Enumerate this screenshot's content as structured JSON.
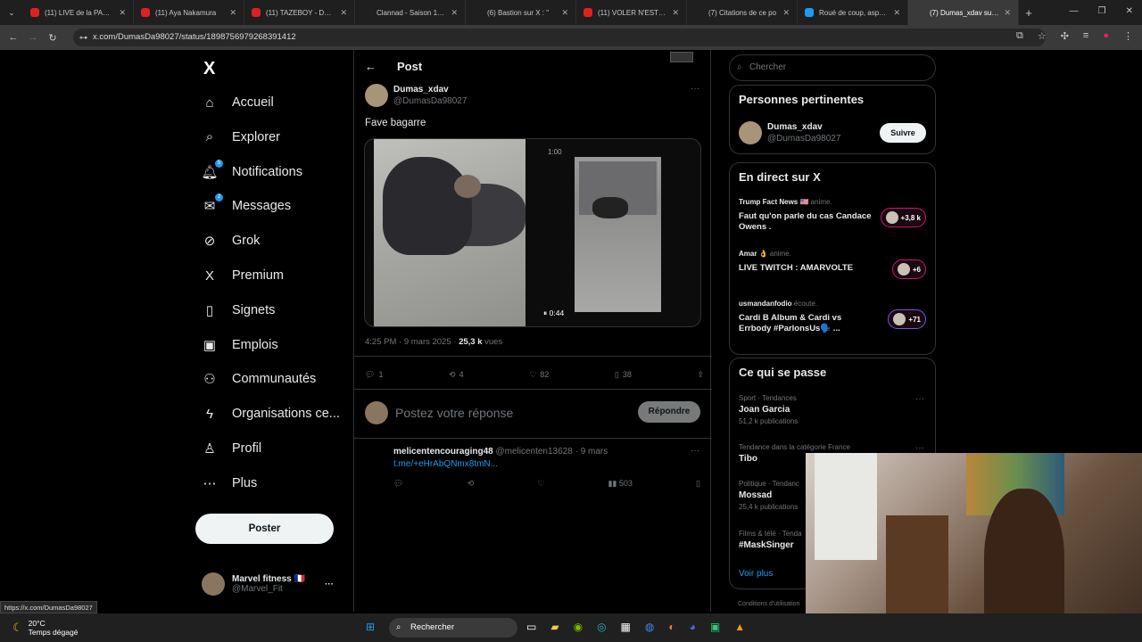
{
  "tabs": [
    {
      "title": "(11) LIVE de la PASSI",
      "color": "#e02020"
    },
    {
      "title": "(11) Aya Nakamura",
      "color": "#e02020"
    },
    {
      "title": "(11) TAZEBOY - Dans",
      "color": "#e02020"
    },
    {
      "title": "Clannad - Saison 1 | A",
      "color": "#ffffff"
    },
    {
      "title": "(6) Bastion sur X : \"",
      "color": "#ffffff"
    },
    {
      "title": "(11) VOLER N'EST PA",
      "color": "#e02020"
    },
    {
      "title": "(7) Citations de ce po",
      "color": "#ffffff"
    },
    {
      "title": "Roué de coup, asperg",
      "color": "#1d9bf0"
    },
    {
      "title": "(7) Dumas_xdav sur X",
      "color": "#ffffff"
    }
  ],
  "browser": {
    "url": "x.com/DumasDa98027/status/1898756979268391412",
    "new_tab": "+"
  },
  "nav": {
    "logo": "X",
    "items": [
      {
        "label": "Accueil",
        "icon": "⌂"
      },
      {
        "label": "Explorer",
        "icon": "⌕"
      },
      {
        "label": "Notifications",
        "icon": "🔔︎",
        "badge": "5"
      },
      {
        "label": "Messages",
        "icon": "✉",
        "badge": "2"
      },
      {
        "label": "Grok",
        "icon": "⊘"
      },
      {
        "label": "Premium",
        "icon": "X"
      },
      {
        "label": "Signets",
        "icon": "▯"
      },
      {
        "label": "Emplois",
        "icon": "▣"
      },
      {
        "label": "Communautés",
        "icon": "⚇"
      },
      {
        "label": "Organisations ce...",
        "icon": "ϟ"
      },
      {
        "label": "Profil",
        "icon": "♙"
      },
      {
        "label": "Plus",
        "icon": "⋯"
      }
    ],
    "post_button": "Poster",
    "me_name": "Marvel fitness 🇫🇷",
    "me_handle": "@Marvel_Fit",
    "me_more": "···"
  },
  "post": {
    "header": "Post",
    "name": "Dumas_xdav",
    "handle": "@DumasDa98027",
    "more": "···",
    "text": "Fave bagarre",
    "video_progress": "1:00",
    "video_time": "0:44",
    "time_date": "4:25 PM · 9 mars 2025 · ",
    "views": "25,3 k",
    "views_label": " vues",
    "replies": "1",
    "reposts": "4",
    "likes": "82",
    "bookmarks": "38",
    "reply_placeholder": "Postez votre réponse",
    "reply_button": "Répondre"
  },
  "comment": {
    "name": "melicentencouraging48",
    "handle": "@melicenten13628 · 9 mars",
    "link": "t.me/+eHrAbQNmx8tmN...",
    "views": "503",
    "more": "···"
  },
  "right": {
    "search_placeholder": "Chercher",
    "relevant_title": "Personnes pertinentes",
    "rel_name": "Dumas_xdav",
    "rel_handle": "@DumasDa98027",
    "follow": "Suivre",
    "live_title": "En direct sur X",
    "lives": [
      {
        "host": "Trump Fact News 🇺🇸",
        "role": " anime.",
        "title": "Faut qu'on parle du cas Candace Owens .",
        "count": "+3,8 k"
      },
      {
        "host": "Amar 👌",
        "role": " anime.",
        "title": "LIVE TWITCH : AMARVOLTE",
        "count": "+6"
      },
      {
        "host": "usmandanfodio",
        "role": " écoute.",
        "title": "Cardi B Album & Cardi vs Errbody #ParlonsUs🗣️ ...",
        "count": "+71"
      }
    ],
    "trends_title": "Ce qui se passe",
    "trends": [
      {
        "meta": "Sport · Tendances",
        "name": "Joan Garcia",
        "count": "51,2 k publications"
      },
      {
        "meta": "Tendance dans la catégorie France",
        "name": "Tibo",
        "count": ""
      },
      {
        "meta": "Politique · Tendanc",
        "name": "Mossad",
        "count": "25,4 k publications"
      },
      {
        "meta": "Films & télé · Tenda",
        "name": "#MaskSinger",
        "count": ""
      }
    ],
    "see_more": "Voir plus",
    "footer": "Conditions d'utilisation"
  },
  "status_url": "https://x.com/DumasDa98027",
  "taskbar": {
    "temp": "20°C",
    "weather": "Temps dégagé",
    "search": "Rechercher"
  }
}
